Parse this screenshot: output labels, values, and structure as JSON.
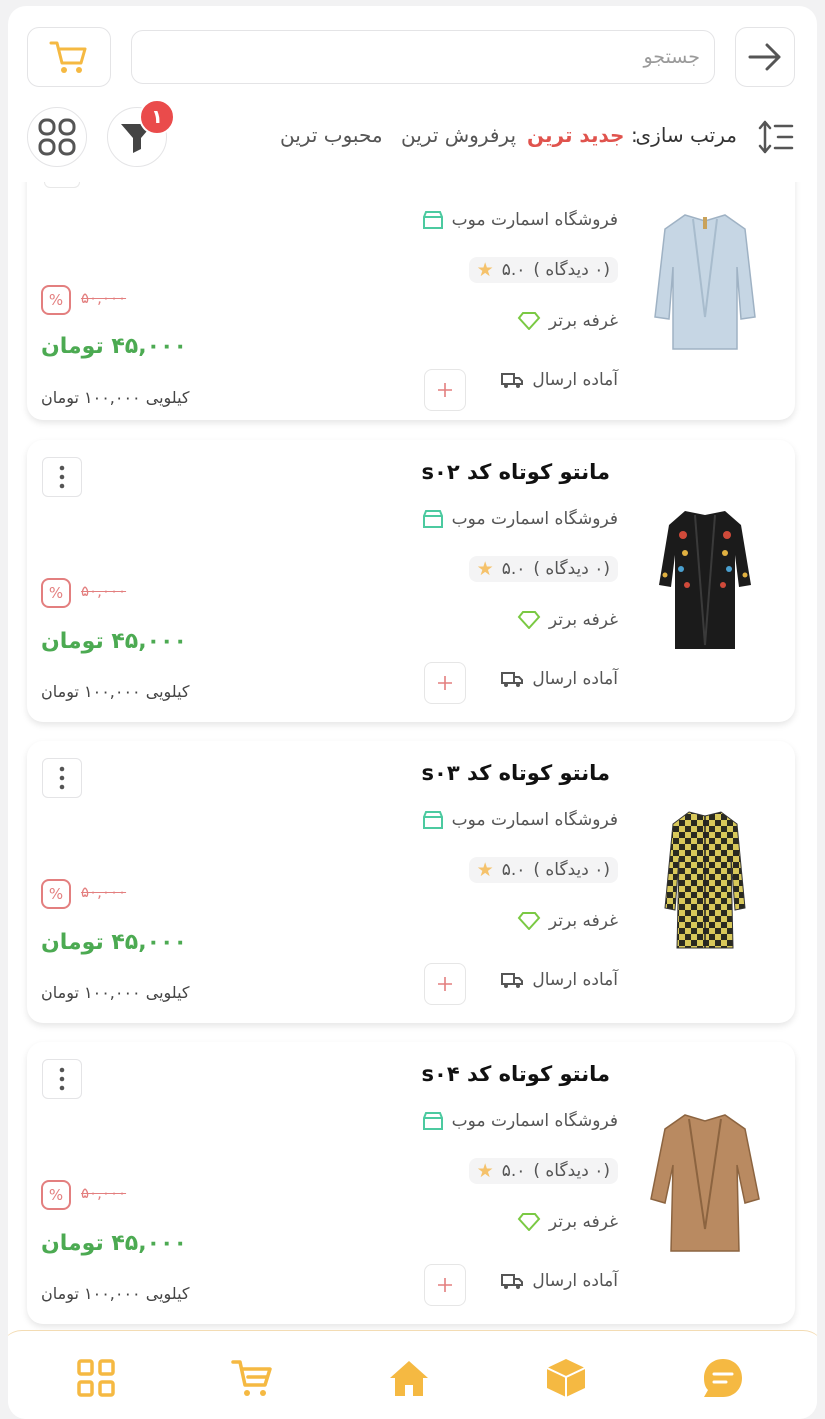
{
  "search": {
    "placeholder": "جستجو"
  },
  "cart_badge": "۱",
  "sort": {
    "label": "مرتب سازی",
    "colon": ":",
    "options": [
      "جدید ترین",
      "پرفروش ترین",
      "محبوب ترین"
    ],
    "active": "جدید ترین"
  },
  "colors": {
    "accent": "#f5b942",
    "price": "#4caa52",
    "discount": "#e37f7f",
    "sort_active": "#e0534d",
    "badge": "#ea4b4b",
    "booth": "#7ac943"
  },
  "products": [
    {
      "title": "",
      "store": "فروشگاه اسمارت موب",
      "rating": "۵.۰",
      "reviews": "(۰ دیدگاه )",
      "booth": "غرفه برتر",
      "shipping": "آماده ارسال",
      "old_price": "۵۰,۰۰۰",
      "price": "۴۵,۰۰۰ تومان",
      "unit_price": "کیلویی ۱۰۰,۰۰۰ تومان",
      "discount_icon": "%",
      "image": "light-blue-blazer"
    },
    {
      "title": "مانتو کوتاه کد s۰۲",
      "store": "فروشگاه اسمارت موب",
      "rating": "۵.۰",
      "reviews": "(۰ دیدگاه )",
      "booth": "غرفه برتر",
      "shipping": "آماده ارسال",
      "old_price": "۵۰,۰۰۰",
      "price": "۴۵,۰۰۰ تومان",
      "unit_price": "کیلویی ۱۰۰,۰۰۰ تومان",
      "discount_icon": "%",
      "image": "black-embroidered-coat"
    },
    {
      "title": "مانتو کوتاه کد s۰۳",
      "store": "فروشگاه اسمارت موب",
      "rating": "۵.۰",
      "reviews": "(۰ دیدگاه )",
      "booth": "غرفه برتر",
      "shipping": "آماده ارسال",
      "old_price": "۵۰,۰۰۰",
      "price": "۴۵,۰۰۰ تومان",
      "unit_price": "کیلویی ۱۰۰,۰۰۰ تومان",
      "discount_icon": "%",
      "image": "plaid-shirt-dress"
    },
    {
      "title": "مانتو کوتاه کد s۰۴",
      "store": "فروشگاه اسمارت موب",
      "rating": "۵.۰",
      "reviews": "(۰ دیدگاه )",
      "booth": "غرفه برتر",
      "shipping": "آماده ارسال",
      "old_price": "۵۰,۰۰۰",
      "price": "۴۵,۰۰۰ تومان",
      "unit_price": "کیلویی ۱۰۰,۰۰۰ تومان",
      "discount_icon": "%",
      "image": "camel-coat"
    }
  ],
  "bottom_nav": [
    "grid-icon",
    "cart-icon",
    "home-icon",
    "box-icon",
    "chat-icon"
  ]
}
